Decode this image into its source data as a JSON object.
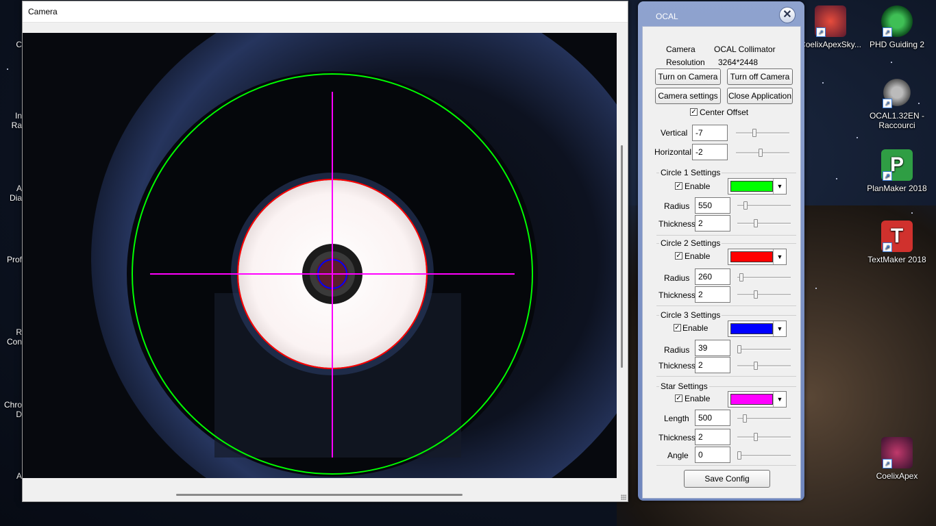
{
  "desktop": {
    "icons": [
      {
        "name": "coelix-apex-sky",
        "label": "CoelixApexSky...",
        "color": "#c0392b"
      },
      {
        "name": "phd-guiding-2",
        "label": "PHD Guiding 2",
        "color": "#2e8b3a"
      },
      {
        "name": "ocal",
        "label": "OCAL1.32EN - Raccourci",
        "color": "#6a6a6a"
      },
      {
        "name": "planmaker-2018",
        "label": "PlanMaker 2018",
        "color": "#2f9e44"
      },
      {
        "name": "textmaker-2018",
        "label": "TextMaker 2018",
        "color": "#d0312d"
      },
      {
        "name": "coelix-apex",
        "label": "CoelixApex",
        "color": "#b03a55"
      }
    ],
    "left_labels": [
      "C",
      "In\nRa",
      "A\nDia",
      "Prof",
      "R\nCon",
      "Chro\nD",
      "A"
    ]
  },
  "camera_window": {
    "title": "Camera"
  },
  "ocal": {
    "title": "OCAL",
    "close_label": "✕",
    "camera_label": "Camera",
    "camera_value": "OCAL Collimator",
    "resolution_label": "Resolution",
    "resolution_value": "3264*2448",
    "turn_on": "Turn on Camera",
    "turn_off": "Turn off Camera",
    "camera_settings": "Camera settings",
    "close_app": "Close Application",
    "center_offset": "Center Offset",
    "center_offset_checked": true,
    "vertical_label": "Vertical",
    "vertical_value": "-7",
    "horizontal_label": "Horizontal",
    "horizontal_value": "-2",
    "circle1": {
      "title": "Circle 1 Settings",
      "enable": "Enable",
      "color": "#00ff00",
      "radius_label": "Radius",
      "radius": "550",
      "thickness_label": "Thickness",
      "thickness": "2"
    },
    "circle2": {
      "title": "Circle 2 Settings",
      "enable": "Enable",
      "color": "#ff0000",
      "radius_label": "Radius",
      "radius": "260",
      "thickness_label": "Thickness",
      "thickness": "2"
    },
    "circle3": {
      "title": "Circle 3 Settings",
      "enable": "Enable",
      "color": "#0000ff",
      "radius_label": "Radius",
      "radius": "39",
      "thickness_label": "Thickness",
      "thickness": "2"
    },
    "star": {
      "title": "Star Settings",
      "enable": "Enable",
      "color": "#ff00ff",
      "length_label": "Length",
      "length": "500",
      "thickness_label": "Thickness",
      "thickness": "2",
      "angle_label": "Angle",
      "angle": "0"
    },
    "save": "Save Config"
  }
}
